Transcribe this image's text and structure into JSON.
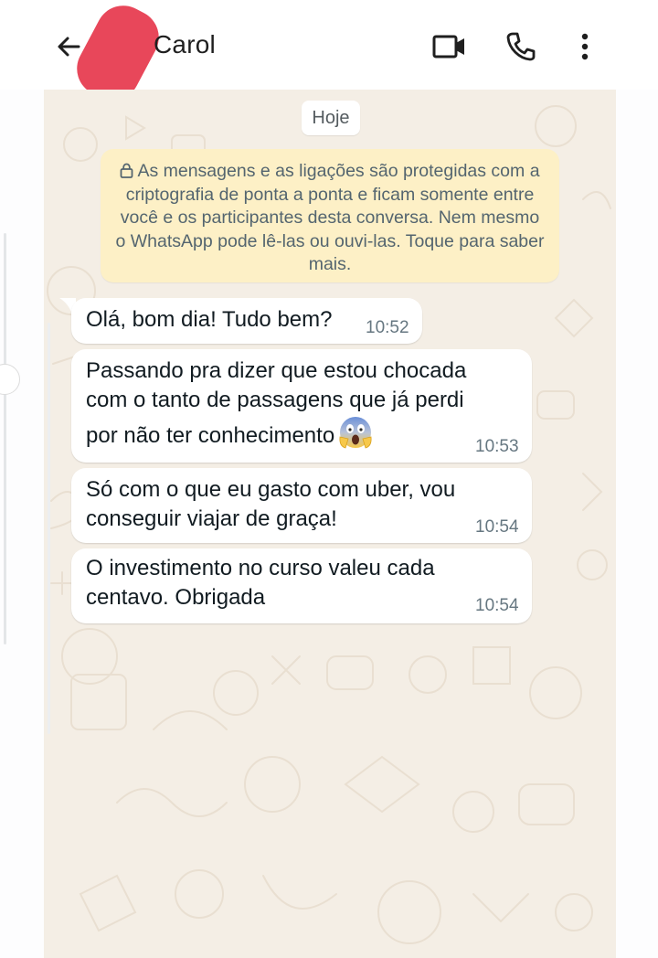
{
  "header": {
    "contact_name": "Carol",
    "back_icon": "arrow-left-icon",
    "video_icon": "video-camera-icon",
    "call_icon": "phone-icon",
    "menu_icon": "more-vertical-icon"
  },
  "chat": {
    "date_label": "Hoje",
    "encryption_notice": "As mensagens e as ligações são protegidas com a criptografia de ponta a ponta e ficam somente entre você e os participantes desta conversa. Nem mesmo o WhatsApp pode lê-las ou ouvi-las. Toque para saber mais.",
    "messages": [
      {
        "text": "Olá, bom dia! Tudo bem?",
        "time": "10:52"
      },
      {
        "text": "Passando pra dizer que estou chocada\ncom o tanto de passagens que já perdi\npor não ter conhecimento",
        "emoji": "screaming-face-emoji",
        "time": "10:53"
      },
      {
        "text": "Só com o que eu gasto com uber, vou\nconseguir viajar de graça!",
        "time": "10:54"
      },
      {
        "text": "O investimento no curso valeu cada\ncentavo. Obrigada",
        "time": "10:54"
      }
    ]
  },
  "colors": {
    "chat_background": "#f4eee5",
    "encryption_banner": "#fdf0c6",
    "bubble": "#ffffff",
    "timestamp": "#667781",
    "redaction": "#e8475a"
  }
}
